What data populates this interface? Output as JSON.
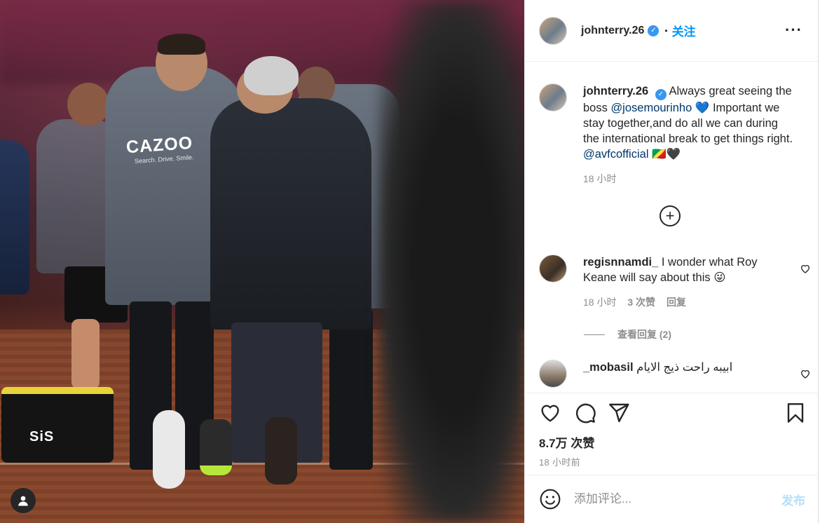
{
  "photo": {
    "description_icon": "user-tag-icon",
    "jacket_text": "CAZOO",
    "jacket_subtext": "Search. Drive. Smile.",
    "box_text": "SiS"
  },
  "header": {
    "username": "johnterry.26",
    "verified_icon": "verified-badge-icon",
    "separator": "•",
    "follow_label": "关注",
    "more_icon": "more-options-icon",
    "more_label": "···"
  },
  "caption": {
    "username": "johnterry.26",
    "text_1": "Always great seeing the boss ",
    "mention_1": "@josemourinho",
    "text_2": " 💙 Important we stay together,and do all we can during the international break to get things right. ",
    "mention_2": "@avfcofficial",
    "text_3": " 🇨🇬🖤",
    "time": "18 小时"
  },
  "load_more": {
    "label": "+"
  },
  "comments": [
    {
      "username": "regisnnamdi_",
      "text": "I wonder what Roy Keane will say about this 😜",
      "time": "18 小时",
      "likes": "3 次赞",
      "reply": "回复",
      "view_replies": "查看回复 (2)"
    },
    {
      "username": "_mobasil",
      "text": "ابيبه راحت ذيج الايام"
    }
  ],
  "actions": {
    "like_icon": "heart-icon",
    "comment_icon": "comment-icon",
    "share_icon": "paper-plane-icon",
    "save_icon": "bookmark-icon",
    "likes": "8.7万 次赞",
    "time_ago": "18 小时前"
  },
  "add_comment": {
    "emoji_icon": "emoji-icon",
    "placeholder": "添加评论...",
    "post_label": "发布"
  },
  "colors": {
    "accent": "#0095f6",
    "post_disabled": "#b2dffc",
    "mention": "#00376b",
    "muted": "#8e8e8e"
  }
}
